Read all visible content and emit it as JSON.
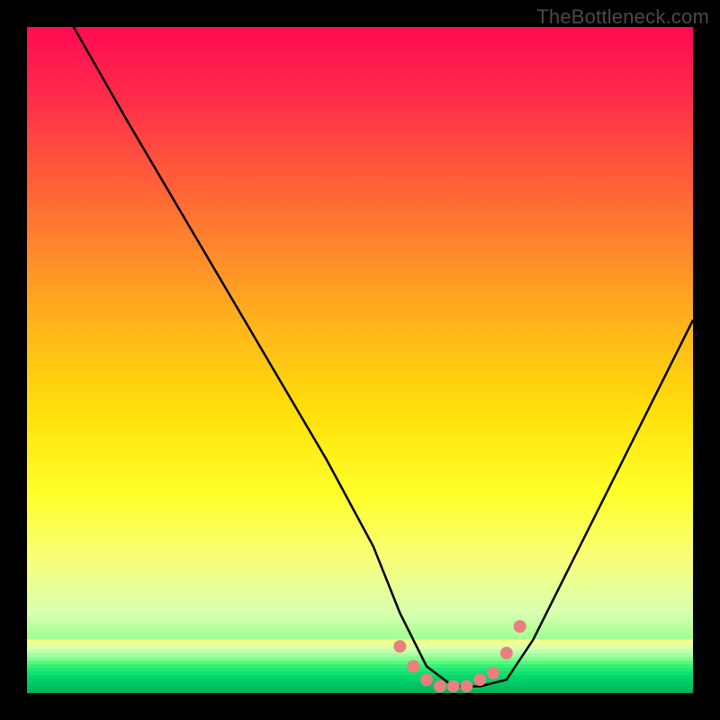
{
  "watermark": "TheBottleneck.com",
  "chart_data": {
    "type": "line",
    "title": "",
    "xlabel": "",
    "ylabel": "",
    "xlim": [
      0,
      100
    ],
    "ylim": [
      0,
      100
    ],
    "series": [
      {
        "name": "curve",
        "x": [
          7,
          15,
          25,
          35,
          45,
          52,
          56,
          60,
          64,
          68,
          72,
          76,
          82,
          90,
          100
        ],
        "y": [
          100,
          86,
          69,
          52,
          35,
          22,
          12,
          4,
          1,
          1,
          2,
          8,
          20,
          36,
          56
        ]
      }
    ],
    "highlight": {
      "color": "#e88080",
      "x": [
        56,
        58,
        60,
        62,
        64,
        66,
        68,
        70,
        72,
        74
      ],
      "y": [
        7,
        4,
        2,
        1,
        1,
        1,
        2,
        3,
        6,
        10
      ]
    },
    "gradient_stops": [
      {
        "pos": 0,
        "color": "#ff0a52"
      },
      {
        "pos": 22,
        "color": "#ff5a3a"
      },
      {
        "pos": 46,
        "color": "#ffb81a"
      },
      {
        "pos": 70,
        "color": "#ffff2a"
      },
      {
        "pos": 100,
        "color": "#00e070"
      }
    ]
  }
}
